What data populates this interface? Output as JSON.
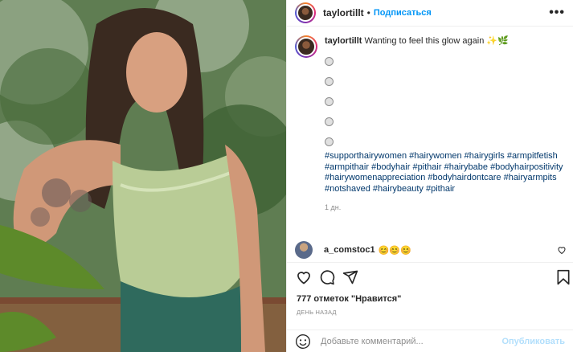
{
  "post": {
    "username": "taylortillt",
    "follow_label": "Подписаться",
    "more_label": "•••"
  },
  "caption": {
    "username": "taylortillt",
    "text": "Wanting to feel this glow again ✨🌿",
    "hashtags": "#supporthairywomen #hairywomen #hairygirls #armpitfetish #armpithair #bodyhair #pithair #hairybabe #bodyhairpositivity #hairywomenappreciation #bodyhairdontcare #hairyarmpits #notshaved #hairybeauty #pithair",
    "time": "1 дн."
  },
  "reply": {
    "username": "a_comstoc1",
    "text": "😊😊😊"
  },
  "actions": {
    "likes": "777 отметок \"Нравится\"",
    "time": "ДЕНЬ НАЗАД"
  },
  "add_comment": {
    "placeholder": "Добавьте комментарий...",
    "publish_label": "Опубликовать"
  },
  "icons": {
    "like": "heart-icon",
    "comment": "comment-icon",
    "share": "paper-plane-icon",
    "save": "bookmark-icon",
    "emoji": "smiley-icon",
    "more": "ellipsis-icon"
  }
}
